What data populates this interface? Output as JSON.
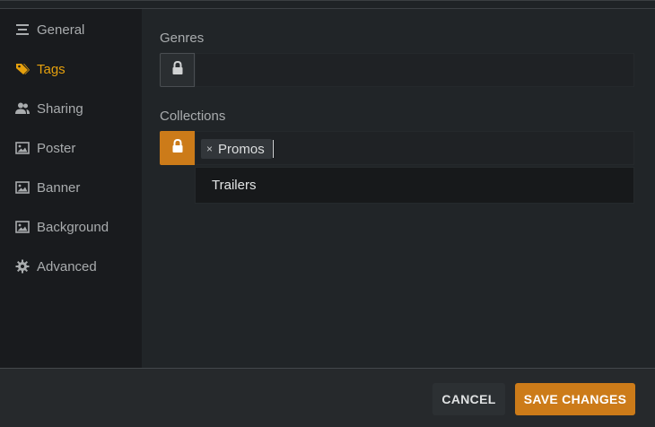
{
  "sidebar": {
    "items": [
      {
        "label": "General",
        "icon": "general-lines-icon",
        "active": false
      },
      {
        "label": "Tags",
        "icon": "tag-icon",
        "active": true
      },
      {
        "label": "Sharing",
        "icon": "users-icon",
        "active": false
      },
      {
        "label": "Poster",
        "icon": "image-icon",
        "active": false
      },
      {
        "label": "Banner",
        "icon": "image-icon",
        "active": false
      },
      {
        "label": "Background",
        "icon": "image-icon",
        "active": false
      },
      {
        "label": "Advanced",
        "icon": "gear-icon",
        "active": false
      }
    ]
  },
  "fields": {
    "genres": {
      "label": "Genres",
      "locked": false,
      "value": ""
    },
    "collections": {
      "label": "Collections",
      "locked": true,
      "tags": [
        {
          "label": "Promos"
        }
      ],
      "suggestions": [
        {
          "label": "Trailers"
        }
      ]
    }
  },
  "footer": {
    "cancel_label": "CANCEL",
    "save_label": "SAVE CHANGES"
  },
  "colors": {
    "accent": "#cc7b19",
    "active_nav": "#e5a00d",
    "sidebar_bg": "#191b1e",
    "main_bg": "#212528"
  }
}
